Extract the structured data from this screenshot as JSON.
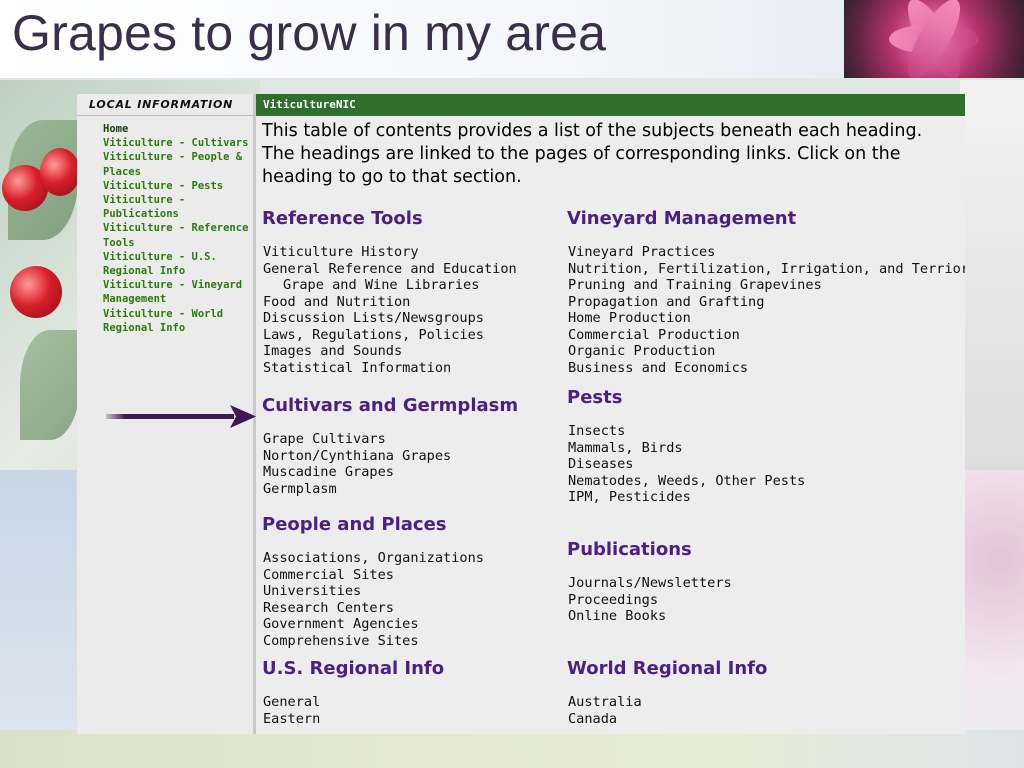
{
  "slide": {
    "title": "Grapes to grow in my area"
  },
  "sidebar": {
    "header": "LOCAL INFORMATION",
    "links": [
      "Home",
      "Viticulture - Cultivars",
      "Viticulture - People & Places",
      "Viticulture - Pests",
      "Viticulture - Publications",
      "Viticulture - Reference Tools",
      "Viticulture - U.S. Regional Info",
      "Viticulture - Vineyard Management",
      "Viticulture - World Regional Info"
    ]
  },
  "content": {
    "header": "ViticultureNIC",
    "intro": "This table of contents provides a list of the subjects beneath each heading. The headings are linked to the pages of corresponding links. Click on the heading to go to that section.",
    "sections": {
      "reference_tools": {
        "title": "Reference Tools",
        "items": [
          "Viticulture History",
          "General Reference and Education",
          "Grape and Wine Libraries",
          "Food and Nutrition",
          "Discussion Lists/Newsgroups",
          "Laws, Regulations, Policies",
          "Images and Sounds",
          "Statistical Information"
        ]
      },
      "cultivars": {
        "title": "Cultivars and Germplasm",
        "items": [
          "Grape Cultivars",
          "Norton/Cynthiana Grapes",
          "Muscadine Grapes",
          "Germplasm"
        ]
      },
      "people_places": {
        "title": "People and Places",
        "items": [
          "Associations, Organizations",
          "Commercial Sites",
          "Universities",
          "Research Centers",
          "Government Agencies",
          "Comprehensive Sites"
        ]
      },
      "us_regional": {
        "title": "U.S. Regional Info",
        "items": [
          "General",
          "Eastern"
        ]
      },
      "vineyard_mgmt": {
        "title": "Vineyard Management",
        "items": [
          "Vineyard Practices",
          "Nutrition, Fertilization, Irrigation, and Terrior",
          "Pruning and Training Grapevines",
          "Propagation and Grafting",
          "Home Production",
          "Commercial Production",
          "Organic Production",
          "Business and Economics"
        ]
      },
      "pests": {
        "title": "Pests",
        "items": [
          "Insects",
          "Mammals, Birds",
          "Diseases",
          "Nematodes, Weeds, Other Pests",
          "IPM, Pesticides"
        ]
      },
      "publications": {
        "title": "Publications",
        "items": [
          "Journals/Newsletters",
          "Proceedings",
          "Online Books"
        ]
      },
      "world_regional": {
        "title": "World Regional Info",
        "items": [
          "Australia",
          "Canada"
        ]
      }
    }
  },
  "colors": {
    "heading": "#4b1f84",
    "sidebar_link": "#2c7a0c",
    "content_header_bg": "#2f6e2c",
    "arrow": "#3d1a52"
  },
  "icons": {
    "pointer_arrow": "arrow-right-icon"
  }
}
